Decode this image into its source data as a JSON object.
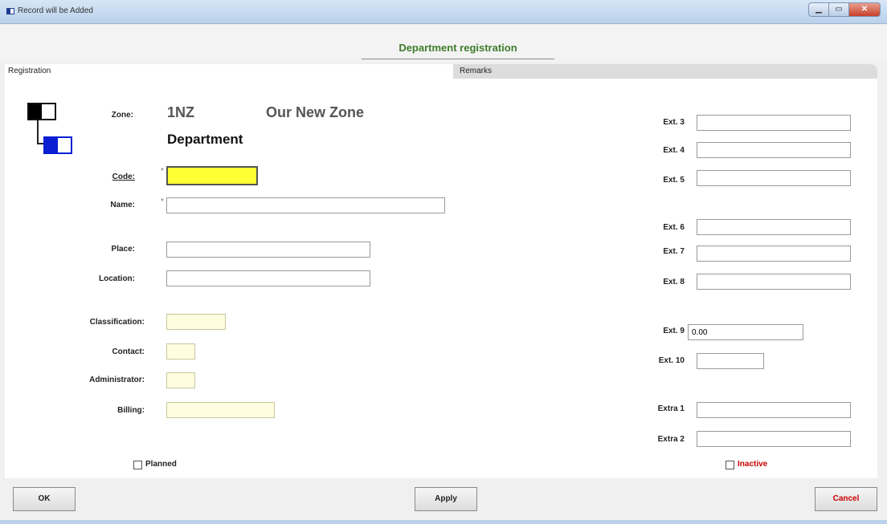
{
  "window": {
    "title": "Record will be Added",
    "minimize_glyph": "▁",
    "restore_glyph": "▭",
    "close_glyph": "✕"
  },
  "header": {
    "title": "Department registration"
  },
  "tabs": [
    {
      "label": "Registration",
      "active": true
    },
    {
      "label": "Remarks",
      "active": false
    }
  ],
  "zone": {
    "label": "Zone:",
    "code": "1NZ",
    "name": "Our New Zone"
  },
  "entity_title": "Department",
  "fields": {
    "code": {
      "label": "Code:",
      "value": "",
      "required_mark": "*"
    },
    "name": {
      "label": "Name:",
      "value": "",
      "required_mark": "*"
    },
    "place": {
      "label": "Place:",
      "value": ""
    },
    "location": {
      "label": "Location:",
      "value": ""
    },
    "classification": {
      "label": "Classification:",
      "value": ""
    },
    "contact": {
      "label": "Contact:",
      "value": ""
    },
    "administrator": {
      "label": "Administrator:",
      "value": ""
    },
    "billing": {
      "label": "Billing:",
      "value": ""
    },
    "ext3": {
      "label": "Ext. 3",
      "value": ""
    },
    "ext4": {
      "label": "Ext. 4",
      "value": ""
    },
    "ext5": {
      "label": "Ext. 5",
      "value": ""
    },
    "ext6": {
      "label": "Ext. 6",
      "value": ""
    },
    "ext7": {
      "label": "Ext. 7",
      "value": ""
    },
    "ext8": {
      "label": "Ext. 8",
      "value": ""
    },
    "ext9": {
      "label": "Ext. 9",
      "value": "0.00"
    },
    "ext10": {
      "label": "Ext. 10",
      "value": ""
    },
    "extra1": {
      "label": "Extra 1",
      "value": ""
    },
    "extra2": {
      "label": "Extra 2",
      "value": ""
    }
  },
  "checkboxes": {
    "planned": {
      "label": "Planned",
      "checked": false
    },
    "inactive": {
      "label": "Inactive",
      "checked": false,
      "color": "#cc0000"
    }
  },
  "buttons": {
    "ok": "OK",
    "apply": "Apply",
    "cancel": "Cancel",
    "cancel_color": "#cc0000"
  },
  "colors": {
    "header_title": "#3e7d2b",
    "active_field": "#ffff33",
    "optional_field": "#fffde0",
    "hierarchy_child": "#0a1ed2"
  }
}
